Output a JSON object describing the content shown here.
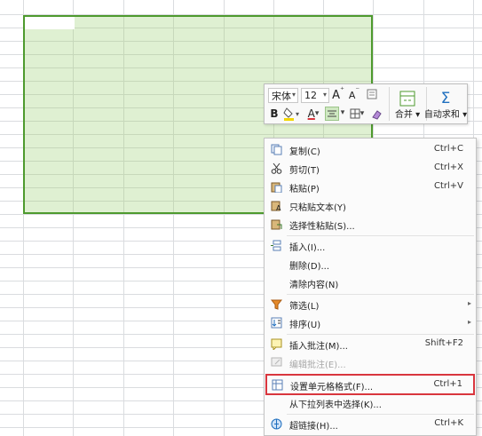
{
  "colors": {
    "selection_fill": "#dff0d2",
    "selection_border": "#4e9a2e",
    "grid_line": "#dadcdf",
    "highlight_box": "#d9363e"
  },
  "toolbar": {
    "font_name": "宋体",
    "font_size": "12",
    "increase_font_label": "A",
    "decrease_font_label": "A",
    "bold_label": "B",
    "font_color_label": "A",
    "merge_label": "合并",
    "autosum_label": "自动求和",
    "sigma_symbol": "Σ"
  },
  "menu": {
    "copy": {
      "label": "复制(C)",
      "shortcut": "Ctrl+C",
      "icon": "copy-icon"
    },
    "cut": {
      "label": "剪切(T)",
      "shortcut": "Ctrl+X",
      "icon": "scissors-icon"
    },
    "paste": {
      "label": "粘贴(P)",
      "shortcut": "Ctrl+V",
      "icon": "paste-icon"
    },
    "paste_text": {
      "label": "只粘贴文本(Y)",
      "icon": "paste-text-icon"
    },
    "paste_special": {
      "label": "选择性粘贴(S)...",
      "icon": "paste-special-icon"
    },
    "insert": {
      "label": "插入(I)...",
      "icon": "insert-icon"
    },
    "delete": {
      "label": "删除(D)..."
    },
    "clear": {
      "label": "清除内容(N)"
    },
    "filter": {
      "label": "筛选(L)",
      "icon": "filter-icon"
    },
    "sort": {
      "label": "排序(U)",
      "icon": "sort-icon"
    },
    "insert_comment": {
      "label": "插入批注(M)...",
      "shortcut": "Shift+F2",
      "icon": "comment-icon"
    },
    "edit_comment": {
      "label": "编辑批注(E)...",
      "icon": "edit-comment-icon"
    },
    "format_cells": {
      "label": "设置单元格格式(F)...",
      "shortcut": "Ctrl+1",
      "icon": "format-cells-icon"
    },
    "pick_from_list": {
      "label": "从下拉列表中选择(K)..."
    },
    "hyperlink": {
      "label": "超链接(H)...",
      "shortcut": "Ctrl+K",
      "icon": "hyperlink-icon"
    }
  }
}
